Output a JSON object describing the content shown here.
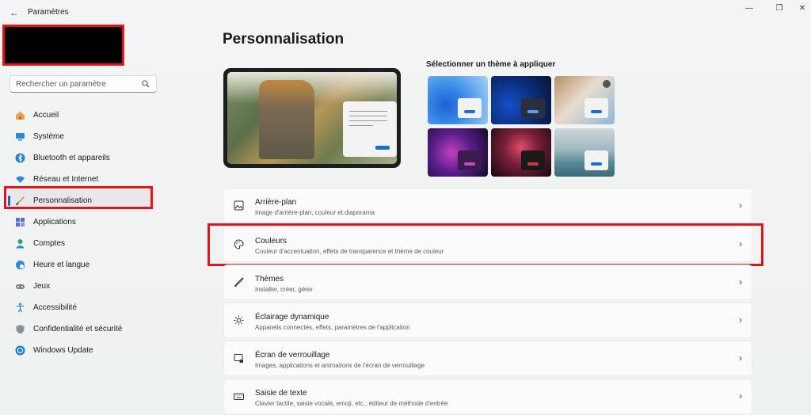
{
  "app": {
    "title": "Paramètres",
    "back_glyph": "←",
    "win_min": "—",
    "win_max": "❐",
    "win_close": "✕"
  },
  "search": {
    "placeholder": "Rechercher un paramètre"
  },
  "sidebar": {
    "items": [
      {
        "label": "Accueil",
        "icon": "home-icon"
      },
      {
        "label": "Système",
        "icon": "monitor-icon"
      },
      {
        "label": "Bluetooth et appareils",
        "icon": "bluetooth-icon"
      },
      {
        "label": "Réseau et Internet",
        "icon": "wifi-icon"
      },
      {
        "label": "Personnalisation",
        "icon": "brush-icon",
        "active": true
      },
      {
        "label": "Applications",
        "icon": "apps-icon"
      },
      {
        "label": "Comptes",
        "icon": "user-icon"
      },
      {
        "label": "Heure et langue",
        "icon": "globe-clock-icon"
      },
      {
        "label": "Jeux",
        "icon": "gamepad-icon"
      },
      {
        "label": "Accessibilité",
        "icon": "accessibility-icon"
      },
      {
        "label": "Confidentialité et sécurité",
        "icon": "shield-icon"
      },
      {
        "label": "Windows Update",
        "icon": "update-icon"
      }
    ]
  },
  "main": {
    "title": "Personnalisation",
    "themes_title": "Sélectionner un thème à appliquer",
    "cards": [
      {
        "title": "Arrière-plan",
        "desc": "Image d'arrière-plan, couleur et diaporama",
        "icon": "image-icon"
      },
      {
        "title": "Couleurs",
        "desc": "Couleur d'accentuation, effets de transparence et thème de couleur",
        "icon": "palette-icon"
      },
      {
        "title": "Thèmes",
        "desc": "Installer, créer, gérer",
        "icon": "brush-icon"
      },
      {
        "title": "Éclairage dynamique",
        "desc": "Appareils connectés, effets, paramètres de l'application",
        "icon": "sun-icon"
      },
      {
        "title": "Écran de verrouillage",
        "desc": "Images, applications et animations de l'écran de verrouillage",
        "icon": "lock-screen-icon"
      },
      {
        "title": "Saisie de texte",
        "desc": "Clavier tactile, saisie vocale, emoji, etc., éditeur de méthode d'entrée",
        "icon": "keyboard-icon"
      }
    ],
    "chevron": "›"
  },
  "colors": {
    "accent": "#1a63c4",
    "highlight": "#e0151b"
  }
}
